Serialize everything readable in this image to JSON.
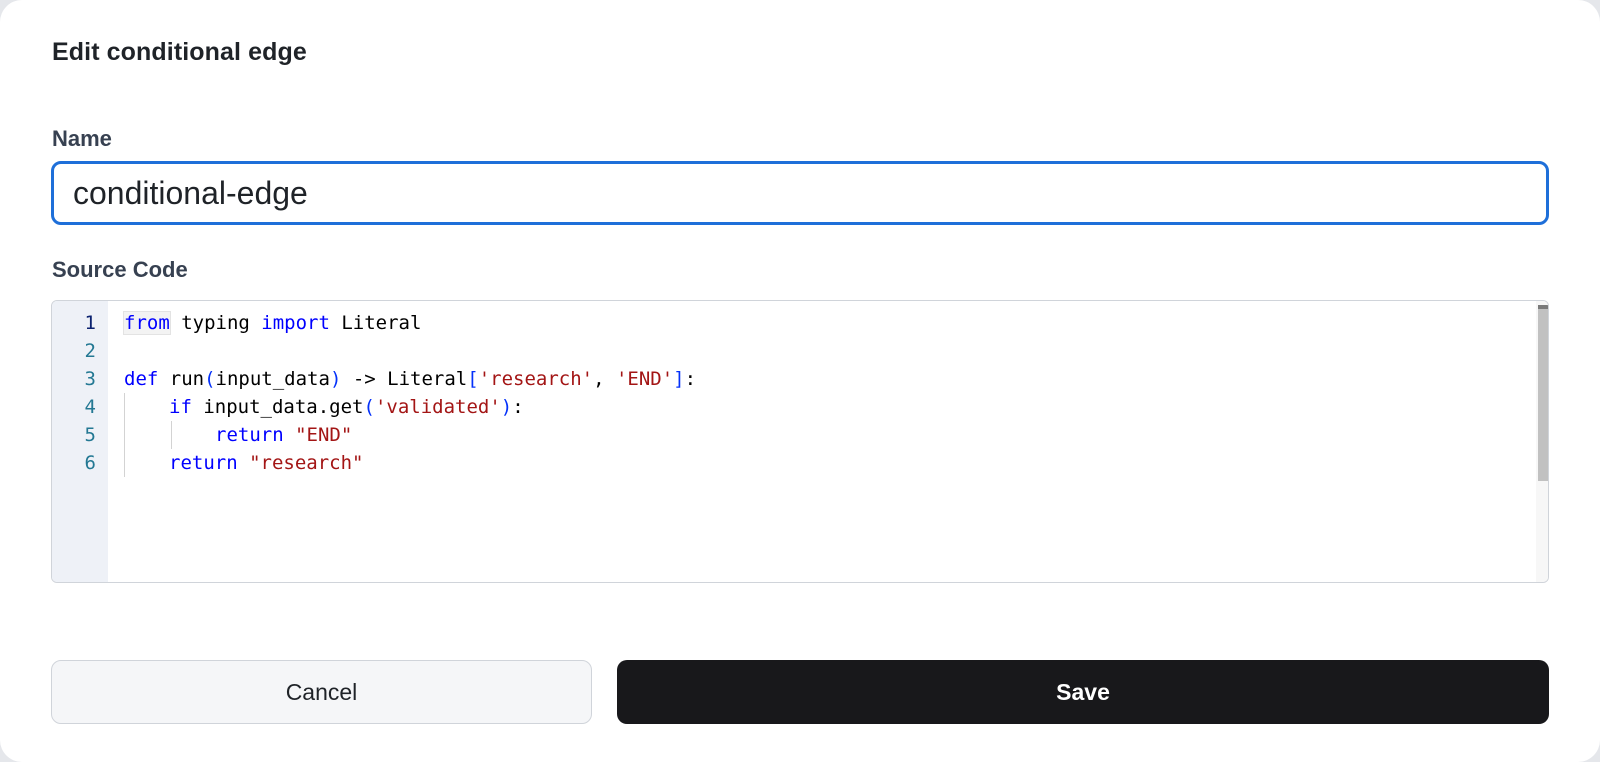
{
  "dialog": {
    "title": "Edit conditional edge"
  },
  "name_field": {
    "label": "Name",
    "value": "conditional-edge"
  },
  "source_field": {
    "label": "Source Code",
    "line_numbers": [
      "1",
      "2",
      "3",
      "4",
      "5",
      "6"
    ],
    "code": {
      "l1": {
        "t1": "from",
        "t2": " typing ",
        "t3": "import",
        "t4": " Literal"
      },
      "l3": {
        "t1": "def",
        "t2": " run",
        "t3": "(",
        "t4": "input_data",
        "t5": ")",
        "t6": " -> Literal",
        "t7": "[",
        "t8": "'research'",
        "t9": ", ",
        "t10": "'END'",
        "t11": "]",
        "t12": ":"
      },
      "l4": {
        "t1": "if",
        "t2": " input_data.get",
        "t3": "(",
        "t4": "'validated'",
        "t5": ")",
        "t6": ":"
      },
      "l5": {
        "t1": "return",
        "t2": " ",
        "t3": "\"END\""
      },
      "l6": {
        "t1": "return",
        "t2": " ",
        "t3": "\"research\""
      }
    }
  },
  "actions": {
    "cancel_label": "Cancel",
    "save_label": "Save"
  },
  "colors": {
    "focus_border": "#1e6fd9",
    "save_bg": "#18181b",
    "keyword": "#0000ff",
    "string": "#a31515",
    "line_number": "#237893"
  }
}
